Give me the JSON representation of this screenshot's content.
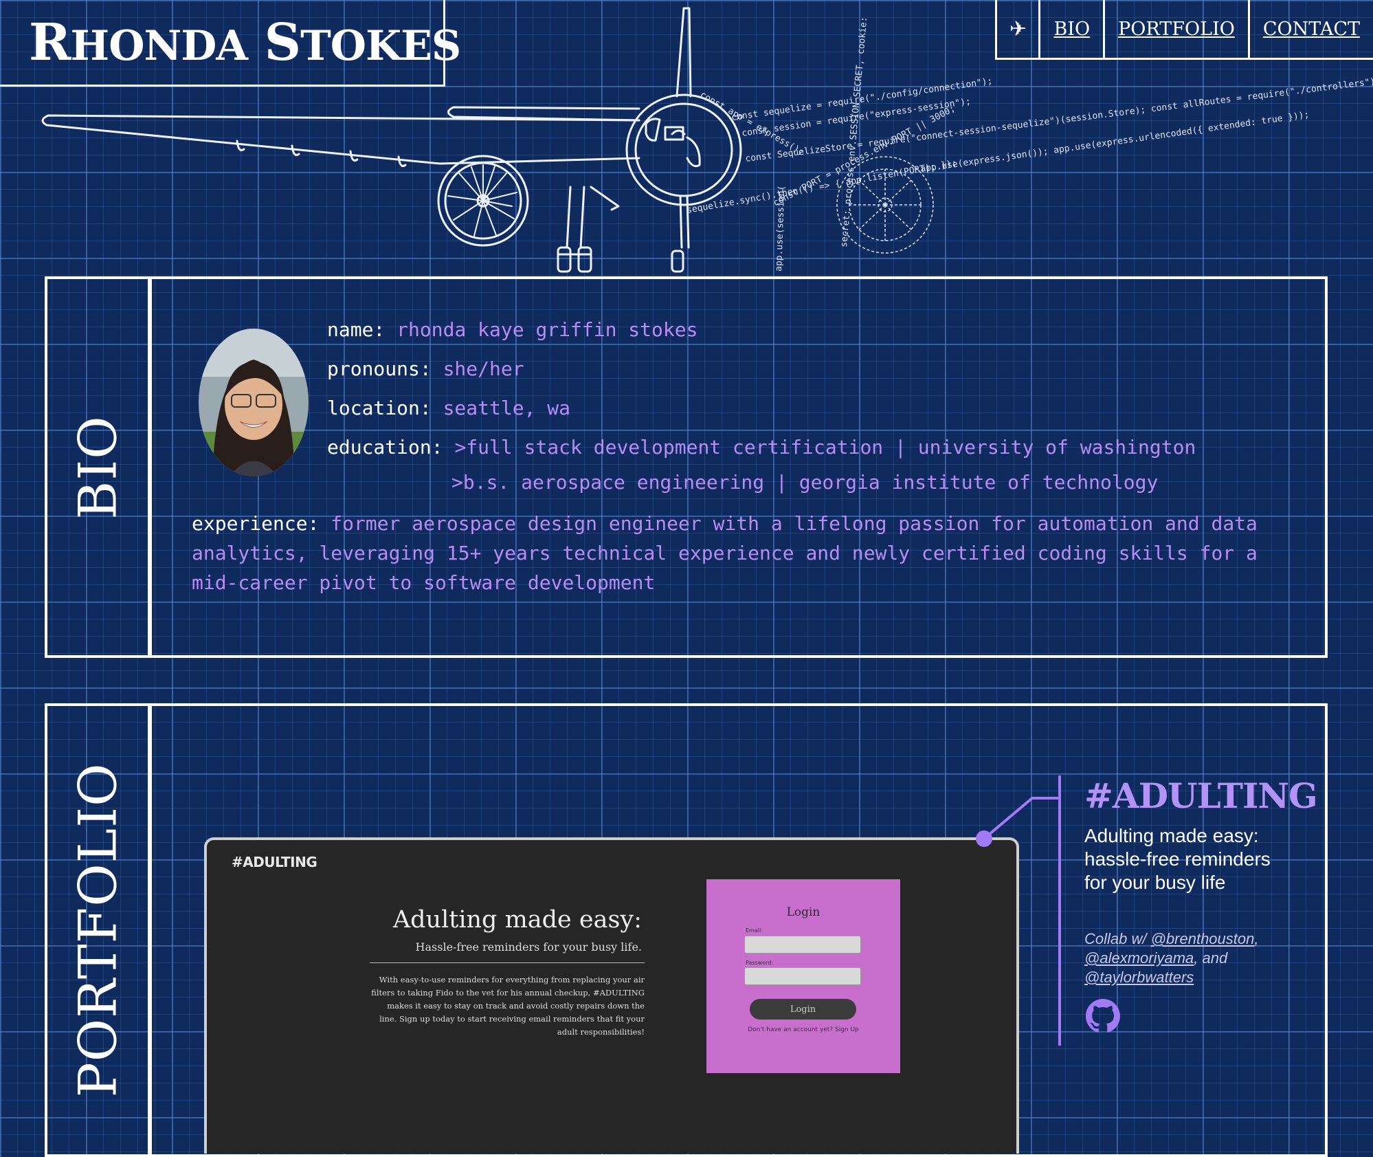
{
  "header": {
    "name_first_initial": "R",
    "name_first_rest": "HONDA",
    "name_last_initial": "S",
    "name_last_rest": "TOKES",
    "nav": {
      "plane_icon": "airplane-icon",
      "items": [
        "BIO",
        "PORTFOLIO",
        "CONTACT"
      ]
    }
  },
  "hero": {
    "code_lines": [
      "const sequelize = require(\"./config/connection\");",
      "const session = require(\"express-session\");",
      "const SequelizeStore = require(\"connect-session-sequelize\")(session.Store); const allRoutes = require(\"./controllers\");",
      "app.use(express.json()); app.use(express.urlencoded({ extended: true }));",
      "const PORT = process.env.PORT || 3000;",
      "secret: process.env.SESSION_SECRET, cookie:",
      "app.use(session(",
      "sequelize.sync().then(() => { app.listen(PORT); });",
      "const app = express();"
    ]
  },
  "bio": {
    "section_label": "BIO",
    "name_key": "name:",
    "name_val": "rhonda kaye griffin stokes",
    "pronouns_key": "pronouns:",
    "pronouns_val": "she/her",
    "location_key": "location:",
    "location_val": "seattle, wa",
    "education_key": "education:",
    "education_1": ">full stack development certification | university of washington",
    "education_2": ">b.s. aerospace engineering | georgia institute of technology",
    "experience_key": "experience:",
    "experience_val": "former aerospace design engineer with a lifelong passion for automation and data analytics, leveraging 15+ years technical experience and newly certified coding skills for a mid-career pivot to software development"
  },
  "portfolio": {
    "section_label": "PORTFOLIO",
    "project": {
      "title": "#ADULTING",
      "description": "Adulting made easy: hassle-free reminders for your busy life",
      "collab_prefix": "Collab w/ ",
      "collaborators": [
        "@brenthouston",
        "@alexmoriyama",
        "@taylorbwatters"
      ],
      "collab_sep1": ", ",
      "collab_sep2": ", and ",
      "github_icon": "github-icon"
    },
    "screenshot": {
      "brand": "#ADULTING",
      "heading": "Adulting made easy:",
      "subheading": "Hassle-free reminders for your busy life.",
      "paragraph": "With easy-to-use reminders for everything from replacing your air filters to taking Fido to the vet for his annual checkup, #ADULTING makes it easy to stay on track and avoid costly repairs down the line. Sign up today to start receiving email reminders that fit your adult responsibilities!",
      "login_title": "Login",
      "email_label": "Email:",
      "password_label": "Password:",
      "login_button": "Login",
      "signup_text": "Don't have an account yet? Sign Up"
    }
  },
  "colors": {
    "background": "#0f2a5c",
    "grid": "#5082d2",
    "accent_purple": "#b98cf5",
    "line_white": "#ffffff"
  }
}
